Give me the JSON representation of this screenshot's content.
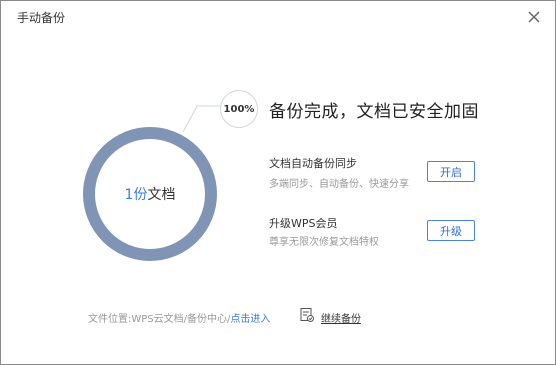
{
  "window": {
    "title": "手动备份",
    "close_icon": "close-icon"
  },
  "progress": {
    "percent_label": "100%",
    "percent": 100,
    "count": "1份",
    "unit": "文档"
  },
  "status": {
    "headline": "备份完成，文档已安全加固"
  },
  "features": [
    {
      "title": "文档自动备份同步",
      "desc": "多端同步、自动备份、快速分享",
      "button": "开启"
    },
    {
      "title": "升级WPS会员",
      "desc": "尊享无限次修复文档特权",
      "button": "升级"
    }
  ],
  "footer": {
    "location_text": "文件位置:WPS云文档/备份中心/",
    "link_text": "点击进入",
    "continue_label": "继续备份",
    "continue_icon": "backup-icon"
  },
  "colors": {
    "ring": "#8095b5",
    "accent": "#3b7ddd",
    "button_border": "#4a86d6"
  }
}
